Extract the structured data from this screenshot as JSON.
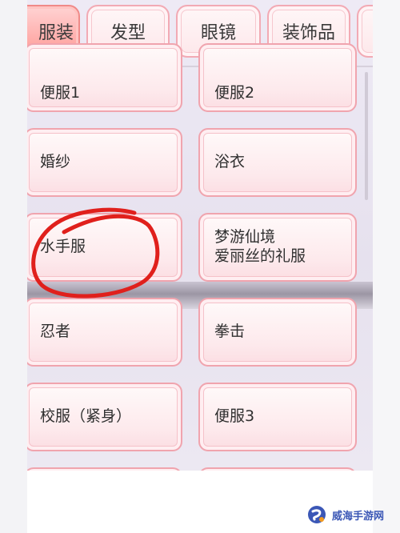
{
  "tabs": [
    {
      "label": "服装",
      "active": true
    },
    {
      "label": "发型",
      "active": false
    },
    {
      "label": "眼镜",
      "active": false
    },
    {
      "label": "装饰品",
      "active": false
    }
  ],
  "grid": {
    "items": [
      {
        "lines": [
          "便服1"
        ]
      },
      {
        "lines": [
          "便服2"
        ]
      },
      {
        "lines": [
          "婚纱"
        ]
      },
      {
        "lines": [
          "浴衣"
        ]
      },
      {
        "lines": [
          "水手服"
        ]
      },
      {
        "lines": [
          "梦游仙境",
          "爱丽丝的礼服"
        ]
      },
      {
        "lines": [
          "忍者"
        ]
      },
      {
        "lines": [
          "拳击"
        ]
      },
      {
        "lines": [
          "校服（紧身）"
        ]
      },
      {
        "lines": [
          "便服3"
        ]
      }
    ]
  },
  "watermark": {
    "text": "威海手游网"
  },
  "colors": {
    "accent": "#f0a4ae",
    "active_tab": "#ff9a96",
    "annotation": "#e0201c"
  }
}
